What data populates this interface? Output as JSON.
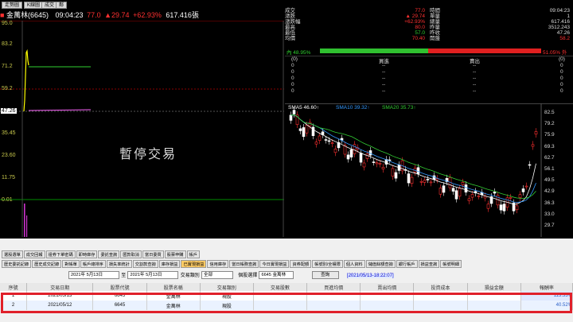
{
  "colors": {
    "up": "#ff3030",
    "down": "#30d030",
    "neutral": "#ffffff",
    "bg": "#000000",
    "accent": "#ffd800"
  },
  "top_tabs": [
    "走勢圖",
    "K線圖",
    "成交",
    "鄰"
  ],
  "ticker": {
    "name": "金萬林(6645)",
    "time": "09:04:23",
    "price": "77.0",
    "arrow_change": "29.74",
    "pct": "+62.93%",
    "volume": "617.416張"
  },
  "y_axis": {
    "labels": [
      "95.0",
      "83.2",
      "71.2",
      "59.2",
      "47.26",
      "35.45",
      "23.60",
      "11.75",
      "0.01"
    ]
  },
  "watermark": "暫停交易",
  "info": {
    "left": [
      {
        "k": "成交",
        "v": "77.0"
      },
      {
        "k": "漲跌",
        "v": "▲ 29.74"
      },
      {
        "k": "漲跌幅",
        "v": "+62.93%"
      },
      {
        "k": "最高",
        "v": "80.0"
      },
      {
        "k": "最低",
        "v": "57.0"
      },
      {
        "k": "均價",
        "v": "70.40"
      }
    ],
    "right": [
      {
        "k": "時間",
        "v": "09:04:23"
      },
      {
        "k": "單量",
        "v": "1"
      },
      {
        "k": "總量",
        "v": "617.416"
      },
      {
        "k": "昨量",
        "v": "3512.243"
      },
      {
        "k": "昨收",
        "v": "47.26"
      },
      {
        "k": "開盤",
        "v": "58.2"
      }
    ],
    "bar_left": "內 48.95%",
    "bar_right": "51.05% 外"
  },
  "bidask": {
    "header_bid": "買進",
    "header_ask": "賣出",
    "col_left": "(0)",
    "col_right": "(0)",
    "rows": [
      [
        "0",
        "--",
        "--",
        "0"
      ],
      [
        "0",
        "--",
        "--",
        "0"
      ],
      [
        "0",
        "--",
        "--",
        "0"
      ],
      [
        "0",
        "--",
        "--",
        "0"
      ],
      [
        "0",
        "--",
        "--",
        "0"
      ]
    ]
  },
  "kchart": {
    "sma5": "SMA5 46.60↑",
    "sma10": "SMA10 39.32↑",
    "sma20": "SMA20 35.73↑",
    "y_labels": [
      "82.5",
      "79.2",
      "75.9",
      "69.3",
      "62.7",
      "56.1",
      "49.5",
      "42.9",
      "36.3",
      "33.0",
      "29.7"
    ]
  },
  "bottom": {
    "tabs1": [
      "選股選單",
      "成交回報",
      "證券下單密碼",
      "即時庫存",
      "委託查詢",
      "匯款取消",
      "當日委買",
      "股票申購",
      "帳戶"
    ],
    "tabs2": [
      "歷史委託記錄",
      "歷史成交記錄",
      "對帳單",
      "帳戶總排序",
      "損失率統計",
      "交割款查詢",
      "庫存損益",
      "已實現損益",
      "信用庫存",
      "當日帳務查詢",
      "今日實現損益",
      "資券配額",
      "帳號別/全權限",
      "個人資料",
      "儲值餘額查詢",
      "銀行帳戶",
      "損益查詢",
      "帳號明細"
    ],
    "filter": {
      "from": "2021年 5月13日",
      "to_label": "至",
      "to": "2021年 5月13日",
      "type_label": "交易類別",
      "type": "全部",
      "stock_label": "個股選擇",
      "stock": "6645 金萬林",
      "btn": "查詢",
      "range": "[2021/05/13-18:22:07]"
    },
    "columns": [
      "序號",
      "交易日期",
      "股票代號",
      "股票名稱",
      "交易類別",
      "交易股數",
      "買進均價",
      "賣出均價",
      "投資成本",
      "損益金額",
      "報酬率"
    ],
    "rows": [
      {
        "no": "1",
        "date": "2021/05/13",
        "code": "6645",
        "name": "金萬林",
        "type": "現股",
        "ret": "113.33%"
      },
      {
        "no": "2",
        "date": "2021/05/12",
        "code": "6645",
        "name": "金萬林",
        "type": "現股",
        "ret": "40.52%"
      }
    ]
  }
}
